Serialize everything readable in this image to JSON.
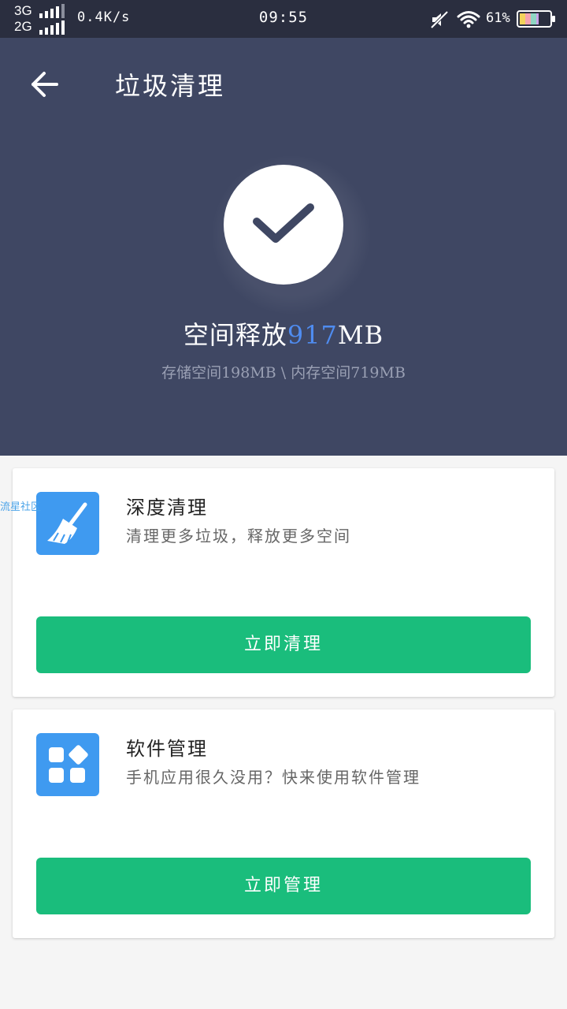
{
  "status_bar": {
    "network_top": "3G",
    "network_bottom": "2G",
    "speed": "0.4K/s",
    "time": "09:55",
    "battery": "61%"
  },
  "header": {
    "title": "垃圾清理"
  },
  "result": {
    "freed_prefix": "空间释放",
    "freed_amount": "917",
    "freed_unit": "MB",
    "breakdown": "存储空间198MB \\ 内存空间719MB"
  },
  "cards": [
    {
      "title": "深度清理",
      "desc": "清理更多垃圾，释放更多空间",
      "button": "立即清理",
      "icon": "broom-icon"
    },
    {
      "title": "软件管理",
      "desc": "手机应用很久没用？快来使用软件管理",
      "button": "立即管理",
      "icon": "apps-grid-icon"
    }
  ],
  "watermark": "流星社区",
  "colors": {
    "status_bar": "#2a2e3f",
    "hero": "#3f4763",
    "accent_blue": "#4f8cf0",
    "icon_blue": "#3f9af0",
    "button_green": "#1abd7c"
  }
}
